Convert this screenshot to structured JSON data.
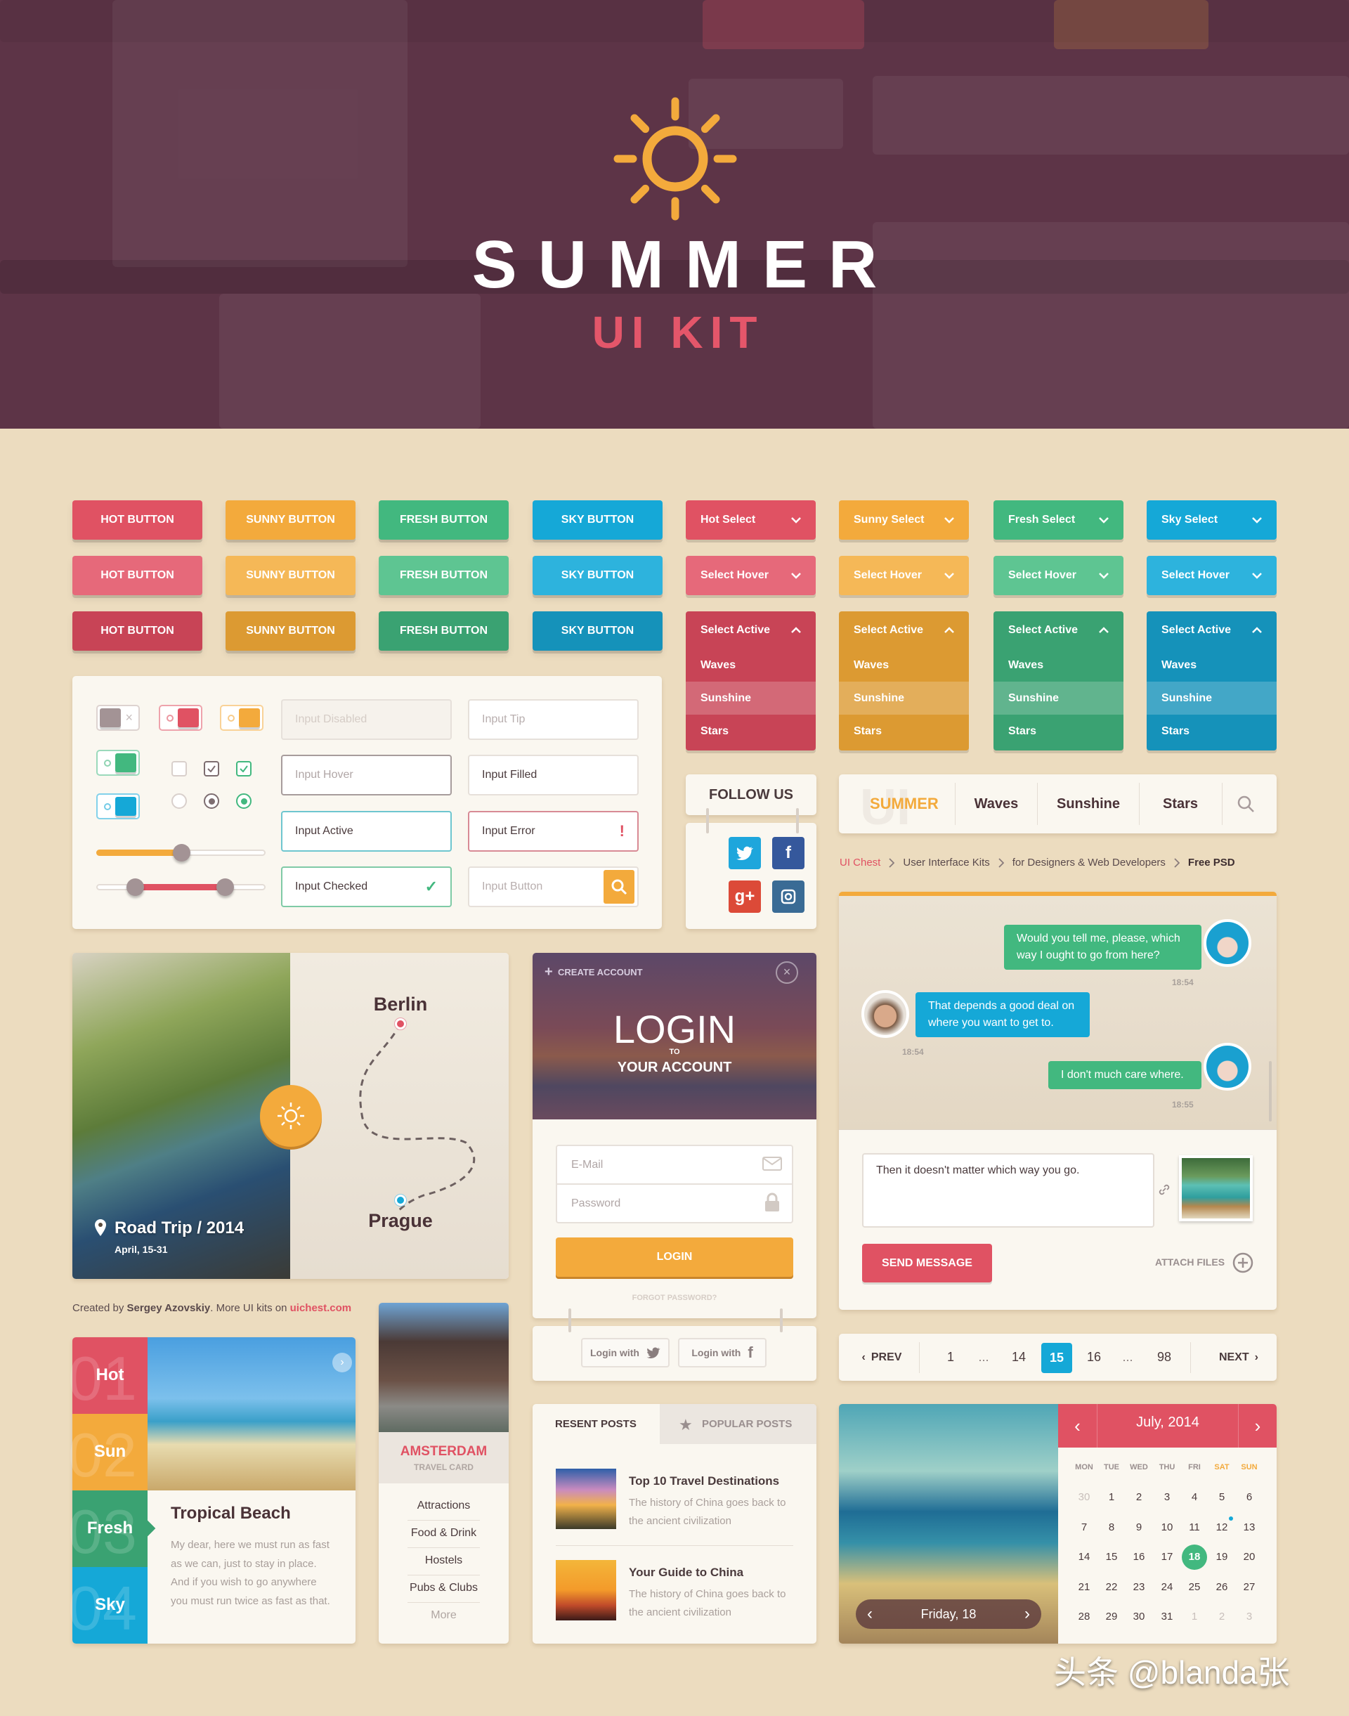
{
  "hero": {
    "title": "SUMMER",
    "subtitle": "UI KIT"
  },
  "palette": {
    "hot": {
      "base": "#e05263",
      "hover": "#e6697a",
      "active": "#c84456"
    },
    "sunny": {
      "base": "#f3aa3c",
      "hover": "#f5b857",
      "active": "#dc9a32"
    },
    "fresh": {
      "base": "#42b87f",
      "hover": "#5ec592",
      "active": "#3aa272"
    },
    "sky": {
      "base": "#15a8d7",
      "hover": "#2db3dd",
      "active": "#1592ba"
    },
    "background": "#ecdcbf",
    "hero_overlay": "#5d3447"
  },
  "buttons": {
    "rows": [
      {
        "state": "normal",
        "labels": [
          "HOT BUTTON",
          "SUNNY BUTTON",
          "FRESH BUTTON",
          "SKY BUTTON"
        ]
      },
      {
        "state": "hover",
        "labels": [
          "HOT BUTTON",
          "SUNNY BUTTON",
          "FRESH BUTTON",
          "SKY BUTTON"
        ]
      },
      {
        "state": "active",
        "labels": [
          "HOT BUTTON",
          "SUNNY BUTTON",
          "FRESH BUTTON",
          "SKY BUTTON"
        ]
      }
    ]
  },
  "selects": {
    "default": [
      "Hot Select",
      "Sunny Select",
      "Fresh Select",
      "Sky Select"
    ],
    "hover": [
      "Select Hover",
      "Select Hover",
      "Select Hover",
      "Select Hover"
    ],
    "active": [
      "Select Active",
      "Select Active",
      "Select Active",
      "Select Active"
    ],
    "options": [
      "Waves",
      "Sunshine",
      "Stars"
    ],
    "highlighted_option": "Sunshine"
  },
  "form": {
    "toggles": [
      {
        "color": "#a39395",
        "on": false,
        "off_mark": "×"
      },
      {
        "color": "#e05263",
        "on": true
      },
      {
        "color": "#f3aa3c",
        "on": true
      },
      {
        "color": "#42b87f",
        "on": true
      },
      {
        "color": "#15a8d7",
        "on": true
      }
    ],
    "checkboxes": [
      {
        "checked": false
      },
      {
        "checked": true,
        "color": "#7d6d70"
      },
      {
        "checked": true,
        "color": "#42b87f"
      }
    ],
    "radios": [
      {
        "selected": false
      },
      {
        "selected": true,
        "color": "#7d6d70"
      },
      {
        "selected": true,
        "color": "#42b87f"
      }
    ],
    "slider_single": 0.5,
    "slider_range": [
      0.23,
      0.76
    ],
    "inputs": [
      {
        "text": "Input Disabled",
        "state": "disabled"
      },
      {
        "text": "Input Tip",
        "state": "placeholder"
      },
      {
        "text": "Input Hover",
        "state": "hover"
      },
      {
        "text": "Input Filled",
        "state": "filled"
      },
      {
        "text": "Input Active",
        "state": "active"
      },
      {
        "text": "Input Error",
        "state": "error",
        "mark": "!"
      },
      {
        "text": "Input Checked",
        "state": "checked",
        "mark": "✓"
      },
      {
        "text": "Input Button",
        "state": "button"
      }
    ]
  },
  "follow": {
    "title": "FOLLOW US",
    "networks": [
      {
        "name": "twitter",
        "color": "#1ea6dc"
      },
      {
        "name": "facebook",
        "color": "#35589c"
      },
      {
        "name": "google-plus",
        "color": "#dc4a38",
        "glyph": "g+"
      },
      {
        "name": "instagram",
        "color": "#3a6b95"
      }
    ]
  },
  "nav": {
    "logo": "SUMMER",
    "logo_bg": "UI",
    "items": [
      "Waves",
      "Sunshine",
      "Stars"
    ]
  },
  "breadcrumb": [
    "UI Chest",
    "User Interface Kits",
    "for Designers & Web Developers",
    "Free PSD"
  ],
  "chat": {
    "messages": [
      {
        "text": "Would you tell me, please, which way I ought to go from here?",
        "time": "18:54",
        "side": "right"
      },
      {
        "text": "That depends a good deal on where you want to get to.",
        "time": "18:54",
        "side": "left"
      },
      {
        "text": "I don't much care where.",
        "time": "18:55",
        "side": "right"
      }
    ],
    "draft": "Then it doesn't matter which way you go.",
    "send": "SEND MESSAGE",
    "attach": "ATTACH FILES"
  },
  "trip": {
    "title": "Road Trip / 2014",
    "dates": "April, 15-31",
    "from": "Berlin",
    "to": "Prague"
  },
  "login": {
    "create": "CREATE ACCOUNT",
    "title": "LOGIN",
    "to": "TO",
    "subtitle": "YOUR ACCOUNT",
    "email_placeholder": "E-Mail",
    "password_placeholder": "Password",
    "button": "LOGIN",
    "forgot": "FORGOT PASSWORD?",
    "social": [
      "Login with",
      "Login with"
    ]
  },
  "credits": {
    "prefix": "Created by ",
    "author": "Sergey Azovskiy",
    "middle": ". More UI kits on ",
    "site": "uichest.com"
  },
  "pagination": {
    "prev": "PREV",
    "next": "NEXT",
    "pages": [
      "1",
      "...",
      "14",
      "15",
      "16",
      "...",
      "98"
    ],
    "current": "15"
  },
  "tabs_card": {
    "tabs": [
      {
        "num": "01",
        "label": "Hot"
      },
      {
        "num": "02",
        "label": "Sun"
      },
      {
        "num": "03",
        "label": "Fresh"
      },
      {
        "num": "04",
        "label": "Sky"
      }
    ],
    "active": "Fresh",
    "title": "Tropical Beach",
    "text": "My dear, here we must run as fast as we can, just to stay in place. And if you wish to go anywhere you must run twice as fast as that."
  },
  "travel_card": {
    "city": "AMSTERDAM",
    "subtitle": "TRAVEL CARD",
    "links": [
      "Attractions",
      "Food & Drink",
      "Hostels",
      "Pubs & Clubs"
    ],
    "more": "More"
  },
  "posts": {
    "tabs": [
      "RESENT POSTS",
      "POPULAR POSTS"
    ],
    "items": [
      {
        "title": "Top 10 Travel Destinations",
        "text": "The history of China goes back to the ancient civilization"
      },
      {
        "title": "Your Guide to China",
        "text": "The history of China goes back to the ancient civilization"
      }
    ]
  },
  "calendar": {
    "month": "July, 2014",
    "weekdays": [
      "MON",
      "TUE",
      "WED",
      "THU",
      "FRI",
      "SAT",
      "SUN"
    ],
    "weeks": [
      [
        "30",
        "1",
        "2",
        "3",
        "4",
        "5",
        "6"
      ],
      [
        "7",
        "8",
        "9",
        "10",
        "11",
        "12",
        "13"
      ],
      [
        "14",
        "15",
        "16",
        "17",
        "18",
        "19",
        "20"
      ],
      [
        "21",
        "22",
        "23",
        "24",
        "25",
        "26",
        "27"
      ],
      [
        "28",
        "29",
        "30",
        "31",
        "1",
        "2",
        "3"
      ]
    ],
    "leading_outside": 1,
    "trailing_outside": 3,
    "selected": "18",
    "event_day": "12",
    "day_label": "Friday, 18"
  },
  "watermark": "头条 @blanda张"
}
